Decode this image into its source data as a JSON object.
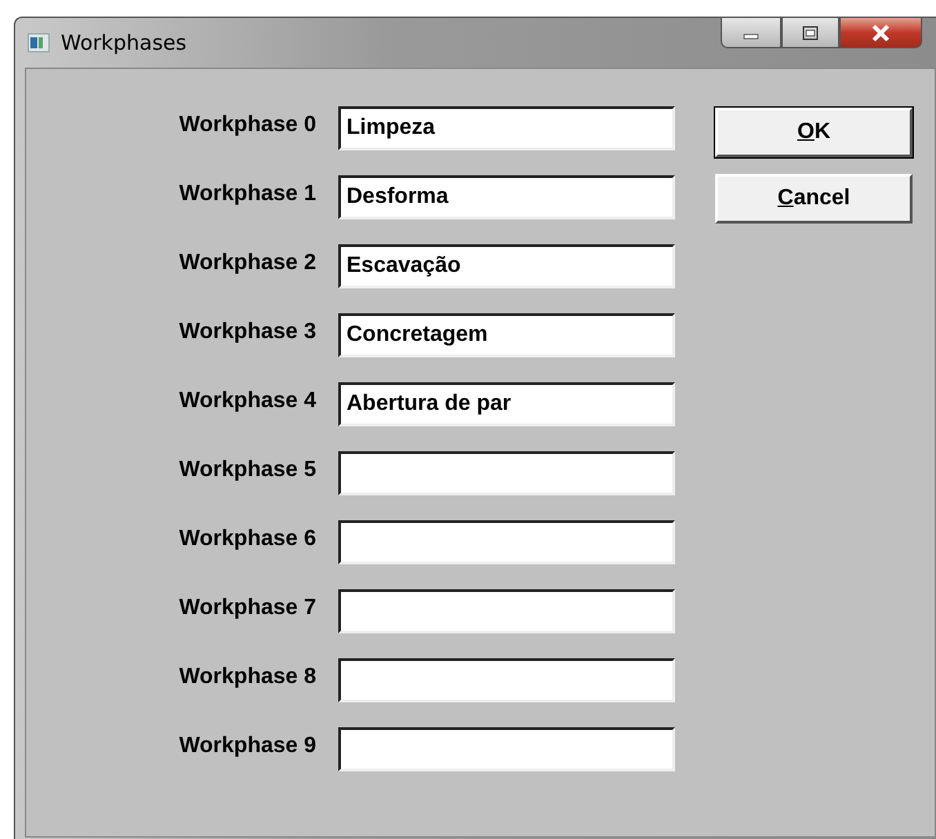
{
  "window": {
    "title": "Workphases"
  },
  "phases": [
    {
      "label": "Workphase 0",
      "value": "Limpeza"
    },
    {
      "label": "Workphase 1",
      "value": "Desforma"
    },
    {
      "label": "Workphase 2",
      "value": "Escavação"
    },
    {
      "label": "Workphase 3",
      "value": "Concretagem"
    },
    {
      "label": "Workphase 4",
      "value": "Abertura de par"
    },
    {
      "label": "Workphase 5"
    },
    {
      "label": "Workphase 6"
    },
    {
      "label": "Workphase 7"
    },
    {
      "label": "Workphase 8"
    },
    {
      "label": "Workphase 9"
    }
  ],
  "buttons": [
    {
      "underlined": "O",
      "rest": "K",
      "default": true
    },
    {
      "underlined": "C",
      "rest": "ancel",
      "default": false
    }
  ]
}
